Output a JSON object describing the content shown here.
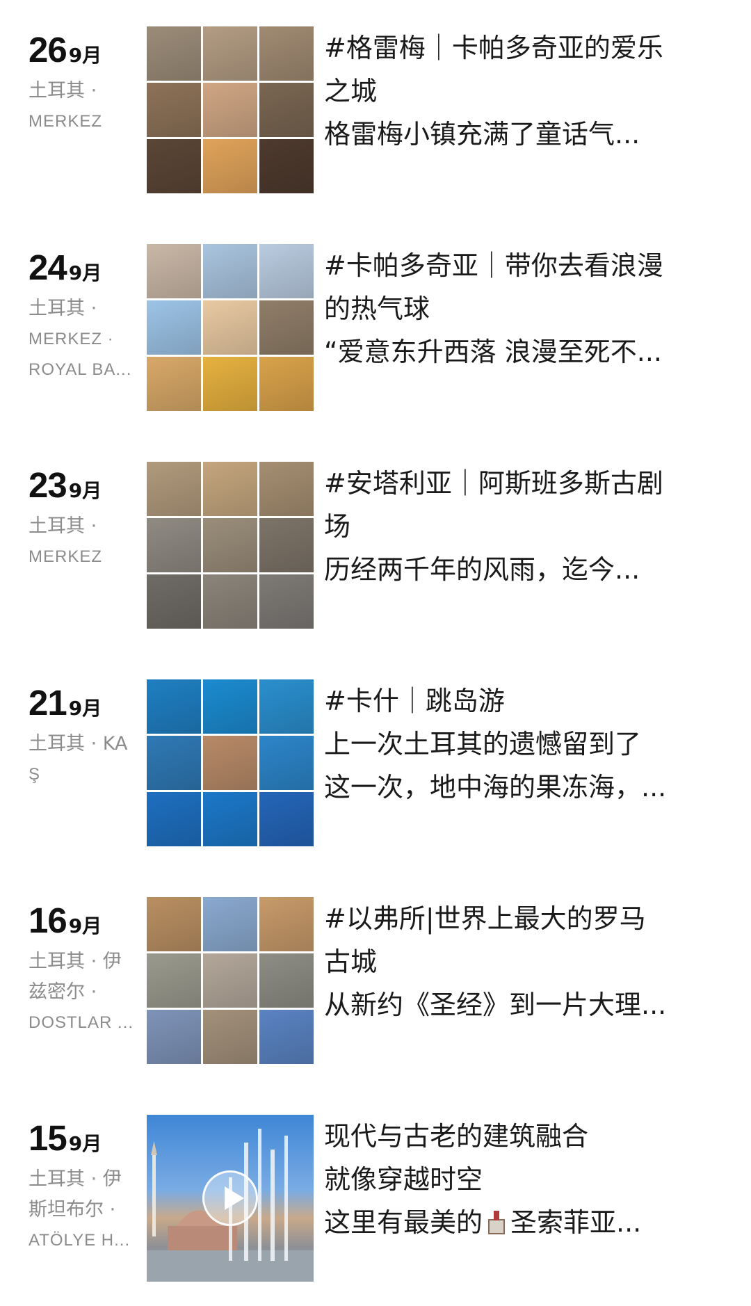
{
  "posts": [
    {
      "day": "26",
      "month": "9月",
      "location": [
        "土耳其 ·",
        "MERKEZ"
      ],
      "caption": [
        "#格雷梅｜卡帕多奇亚的爱乐",
        "之城",
        "格雷梅小镇充满了童话气..."
      ],
      "thumb_colors": [
        "#9b8c78",
        "#b39c83",
        "#a08a72",
        "#8d7258",
        "#cfa684",
        "#7a6652",
        "#5b4636",
        "#e0a35a",
        "#4e3a2e"
      ],
      "thumb_name": "cappadocia-goreme-photos"
    },
    {
      "day": "24",
      "month": "9月",
      "location": [
        "土耳其 ·",
        "MERKEZ ·",
        "ROYAL BA..."
      ],
      "caption": [
        "#卡帕多奇亚｜带你去看浪漫",
        "的热气球",
        "“爱意东升西落 浪漫至死不..."
      ],
      "thumb_colors": [
        "#c9b7a6",
        "#a9c4de",
        "#b9cbe0",
        "#9cc3e6",
        "#e8c9a2",
        "#8f7d68",
        "#d8a868",
        "#e6b13f",
        "#d9a24a"
      ],
      "thumb_name": "hot-air-balloon-photos"
    },
    {
      "day": "23",
      "month": "9月",
      "location": [
        "土耳其 ·",
        "MERKEZ"
      ],
      "caption": [
        "#安塔利亚｜阿斯班多斯古剧",
        "场",
        "历经两千年的风雨，迄今..."
      ],
      "thumb_colors": [
        "#b19a7c",
        "#c4a67e",
        "#a58e71",
        "#8f8a82",
        "#9a8d7a",
        "#7d7468",
        "#6f6b66",
        "#8b847a",
        "#7d7a76"
      ],
      "thumb_name": "aspendos-theatre-photos"
    },
    {
      "day": "21",
      "month": "9月",
      "location": [
        "土耳其 · KA",
        "Ş"
      ],
      "caption": [
        "#卡什｜跳岛游",
        "上一次土耳其的遗憾留到了",
        "这一次，地中海的果冻海，..."
      ],
      "thumb_colors": [
        "#1f7fc2",
        "#1b8bd0",
        "#2a8fce",
        "#2f79b5",
        "#b78a68",
        "#2c85c9",
        "#1e6fc0",
        "#1c78c8",
        "#2465b8"
      ],
      "thumb_name": "kas-island-hopping-photos"
    },
    {
      "day": "16",
      "month": "9月",
      "location": [
        "土耳其 · 伊",
        "兹密尔 ·",
        "DOSTLAR ..."
      ],
      "caption": [
        "#以弗所|世界上最大的罗马",
        "古城",
        "从新约《圣经》到一片大理..."
      ],
      "thumb_colors": [
        "#b98f62",
        "#8aa9cf",
        "#c79a6a",
        "#9a9a8e",
        "#b3a79a",
        "#8e8d84",
        "#7e93b8",
        "#a2907a",
        "#5a83c2"
      ],
      "thumb_name": "ephesus-ruins-photos"
    },
    {
      "day": "15",
      "month": "9月",
      "location": [
        "土耳其 · 伊",
        "斯坦布尔 ·",
        "ATÖLYE H..."
      ],
      "caption_lines": [
        {
          "text": "现代与古老的建筑融合"
        },
        {
          "text": "就像穿越时空"
        },
        {
          "pre": "这里有最美的",
          "emoji": "church-icon",
          "post": "圣索菲亚..."
        }
      ],
      "thumb_name": "hagia-sophia-fountain-video"
    }
  ]
}
